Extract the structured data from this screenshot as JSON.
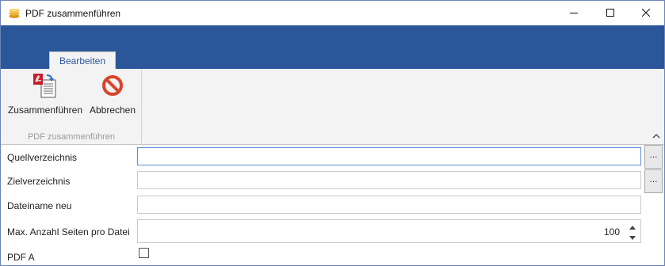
{
  "window": {
    "title": "PDF zusammenführen",
    "app_icon": "coins-icon",
    "controls": [
      "minimize-icon",
      "maximize-icon",
      "close-icon"
    ]
  },
  "ribbon": {
    "tabs": [
      {
        "label": "Bearbeiten",
        "active": true
      }
    ],
    "groups": [
      {
        "label": "PDF zusammenführen",
        "buttons": [
          {
            "label": "Zusammenführen",
            "icon": "pdf-merge-icon"
          },
          {
            "label": "Abbrechen",
            "icon": "cancel-icon"
          }
        ]
      }
    ],
    "collapse_icon": "chevron-up-icon"
  },
  "form": {
    "source_dir": {
      "label": "Quellverzeichnis",
      "value": "",
      "browse_label": "..."
    },
    "target_dir": {
      "label": "Zielverzeichnis",
      "value": "",
      "browse_label": "..."
    },
    "new_filename": {
      "label": "Dateiname neu",
      "value": ""
    },
    "max_pages": {
      "label": "Max. Anzahl Seiten pro Datei",
      "value": "100"
    },
    "pdf_a": {
      "label": "PDF A",
      "checked": false
    }
  },
  "colors": {
    "ribbon_blue": "#2b579a",
    "ribbon_body": "#f3f3f3",
    "focus_border": "#5b8ed3",
    "cancel_red": "#d9442a",
    "pdf_red": "#c8202a"
  }
}
